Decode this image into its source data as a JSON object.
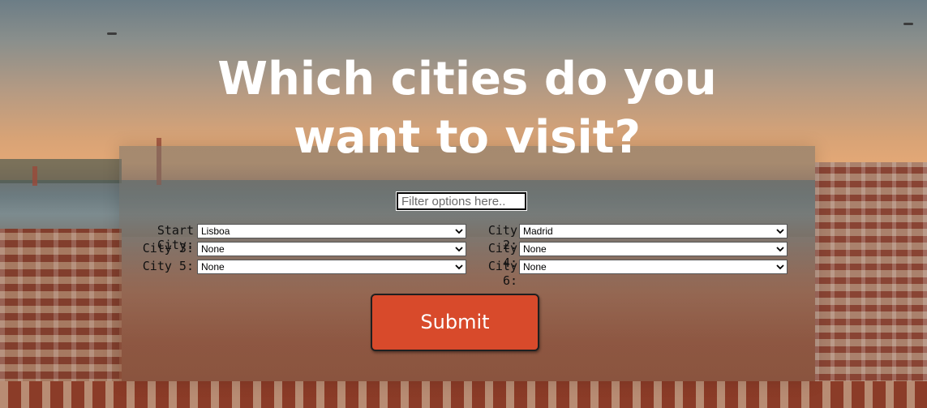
{
  "page": {
    "title_line1": "Which cities do you",
    "title_line2": "want to visit?"
  },
  "filter": {
    "placeholder": "Filter options here.."
  },
  "cities": [
    {
      "label": "Start City:",
      "value": "Lisboa"
    },
    {
      "label": "City 2:",
      "value": "Madrid"
    },
    {
      "label": "City 3:",
      "value": "None"
    },
    {
      "label": "City 4:",
      "value": "None"
    },
    {
      "label": "City 5:",
      "value": "None"
    },
    {
      "label": "City 6:",
      "value": "None"
    }
  ],
  "submit": {
    "label": "Submit"
  },
  "colors": {
    "submit_bg": "#d84a2b",
    "title_text": "#ffffff"
  },
  "icons": {
    "select_chevron": "chevron-down-icon"
  }
}
